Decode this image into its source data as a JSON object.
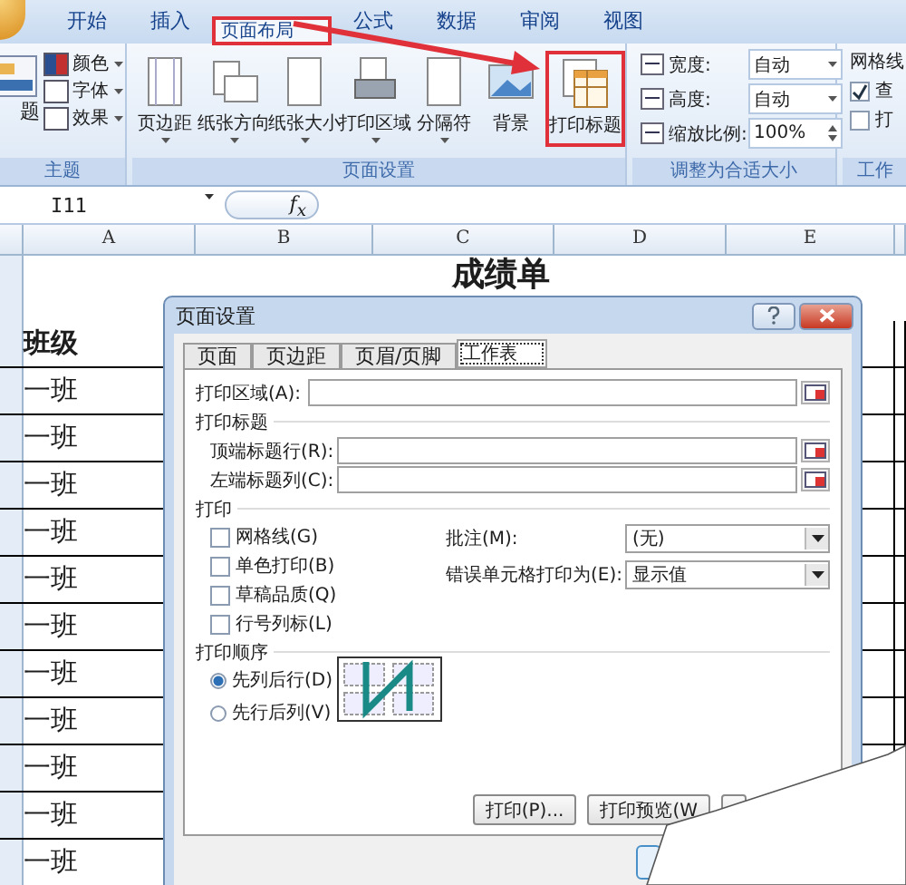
{
  "ribbon_tabs": [
    {
      "label": "开始",
      "selected": false,
      "callout": false
    },
    {
      "label": "插入",
      "selected": false,
      "callout": false
    },
    {
      "label": "页面布局",
      "selected": true,
      "callout": true
    },
    {
      "label": "公式",
      "selected": false,
      "callout": false
    },
    {
      "label": "数据",
      "selected": false,
      "callout": false
    },
    {
      "label": "审阅",
      "selected": false,
      "callout": false
    },
    {
      "label": "视图",
      "selected": false,
      "callout": false
    }
  ],
  "theme_group": {
    "label": "主题",
    "main": "题",
    "items": [
      "颜色",
      "字体",
      "效果"
    ]
  },
  "page_setup_group": {
    "label": "页面设置",
    "buttons": [
      {
        "label": "页边距",
        "kind": "margins",
        "dropdown": true,
        "callout": false
      },
      {
        "label": "纸张方向",
        "kind": "orientation",
        "dropdown": true,
        "callout": false
      },
      {
        "label": "纸张大小",
        "kind": "size",
        "dropdown": true,
        "callout": false
      },
      {
        "label": "打印区域",
        "kind": "printarea",
        "dropdown": true,
        "callout": false
      },
      {
        "label": "分隔符",
        "kind": "breaks",
        "dropdown": true,
        "callout": false
      },
      {
        "label": "背景",
        "kind": "background",
        "dropdown": false,
        "callout": false
      },
      {
        "label": "打印标题",
        "kind": "titles",
        "dropdown": false,
        "callout": true
      }
    ]
  },
  "scale_group": {
    "label": "调整为合适大小",
    "rows": [
      {
        "label": "宽度:",
        "value": "自动",
        "kind": "dropdown"
      },
      {
        "label": "高度:",
        "value": "自动",
        "kind": "dropdown"
      },
      {
        "label": "缩放比例:",
        "value": "100%",
        "kind": "spin"
      }
    ]
  },
  "sheet_options_group": {
    "label": "工作",
    "heading": "网格线",
    "checks": [
      {
        "label": "查",
        "checked": true
      },
      {
        "label": "打",
        "checked": false
      }
    ]
  },
  "formula_bar": {
    "name_box": "I11",
    "fx": "f$_{x}$"
  },
  "sheet": {
    "columns": [
      "A",
      "B",
      "C",
      "D",
      "E"
    ],
    "title": "成绩单",
    "header": "班级",
    "rows": [
      "一班",
      "一班",
      "一班",
      "一班",
      "一班",
      "一班",
      "一班",
      "一班",
      "一班",
      "一班",
      "一班"
    ]
  },
  "dialog": {
    "title": "页面设置",
    "tabs": [
      {
        "label": "页面",
        "selected": false
      },
      {
        "label": "页边距",
        "selected": false
      },
      {
        "label": "页眉/页脚",
        "selected": false
      },
      {
        "label": "工作表",
        "selected": true
      }
    ],
    "print_area_label": "打印区域(A):",
    "print_titles_heading": "打印标题",
    "title_fields": [
      "顶端标题行(R):",
      "左端标题列(C):"
    ],
    "print_heading": "打印",
    "print_checks": [
      {
        "label": "网格线(G)",
        "checked": false
      },
      {
        "label": "单色打印(B)",
        "checked": false
      },
      {
        "label": "草稿品质(Q)",
        "checked": false
      },
      {
        "label": "行号列标(L)",
        "checked": false
      }
    ],
    "selects": [
      {
        "label": "批注(M):",
        "value": "(无)"
      },
      {
        "label": "错误单元格打印为(E):",
        "value": "显示值"
      }
    ],
    "order_heading": "打印顺序",
    "order_options": [
      {
        "label": "先列后行(D)",
        "selected": true
      },
      {
        "label": "先行后列(V)",
        "selected": false
      }
    ],
    "buttons": [
      "打印(P)...",
      "打印预览(W"
    ]
  }
}
